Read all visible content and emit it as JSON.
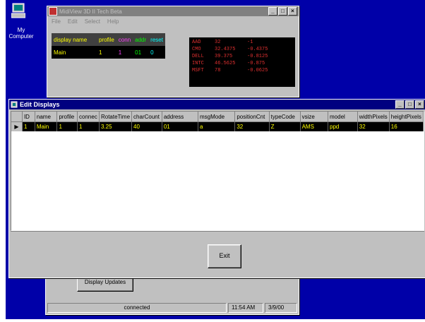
{
  "desktop": {
    "my_computer_label": "My Computer",
    "bg_color": "#0000a8"
  },
  "back_window": {
    "title": "MidiView 3D II Tech Beta",
    "controls": {
      "minimize": "_",
      "maximize": "□",
      "close": "×"
    },
    "menu": [
      "File",
      "Edit",
      "Select",
      "Help"
    ],
    "table": {
      "headers": [
        "display name",
        "profile",
        "conn",
        "addr",
        "reset"
      ],
      "header_colors": [
        "#ffff00",
        "#ffff00",
        "#ff40ff",
        "#00ff00",
        "#00ffff"
      ],
      "row": [
        "Main",
        "1",
        "1",
        "01",
        "0"
      ]
    },
    "ticker": [
      [
        "AAD",
        "32",
        "-1"
      ],
      [
        "CMO",
        "32.4375",
        "-0.4375"
      ],
      [
        "DELL",
        "39.375",
        "-0.8125"
      ],
      [
        "INTC",
        "46.5625",
        "-0.875"
      ],
      [
        "MSFT",
        "78",
        "-0.0625"
      ]
    ]
  },
  "bottom_window": {
    "button": "Display Updates",
    "status": {
      "connection": "connected",
      "time": "11:54 AM",
      "date": "3/9/00"
    }
  },
  "edit_window": {
    "title": "Edit Displays",
    "controls": {
      "minimize": "_",
      "maximize": "□",
      "close": "×"
    },
    "columns": [
      "ID",
      "name",
      "profile",
      "connec",
      "RotateTime",
      "charCount",
      "address",
      "msgMode",
      "positionCnt",
      "typeCode",
      "vsize",
      "model",
      "widthPixels",
      "heightPixels"
    ],
    "row": [
      "1",
      "Main",
      "1",
      "1",
      "3.25",
      "40",
      "01",
      "a",
      "32",
      "Z",
      "AMS",
      "ppd",
      "32",
      "16"
    ],
    "exit_label": "Exit"
  }
}
